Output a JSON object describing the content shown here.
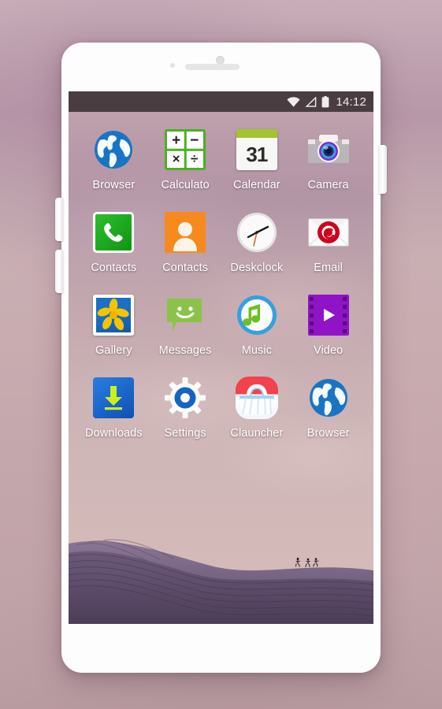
{
  "device": {
    "kind": "smartphone-mockup",
    "frame_color": "#fdfdfd",
    "buttons": [
      "volume-up",
      "volume-down",
      "power"
    ]
  },
  "background": {
    "color_top": "#c9aeb8",
    "color_bottom": "#b99ca2"
  },
  "screen": {
    "statusbar": {
      "background": "#4a3d42",
      "time": "14:12",
      "icons": [
        "wifi-icon",
        "signal-icon",
        "battery-icon"
      ]
    },
    "wallpaper": {
      "description": "lavender dunes with distant runners",
      "runner_glyphs": "\u0003\u0003\u0003",
      "dune_color": "#5d4a68",
      "sky_color": "#c6aab0"
    },
    "apps": [
      {
        "label": "Browser",
        "icon": "globe-icon",
        "accent": "#1a74c4"
      },
      {
        "label": "Calculato",
        "icon": "calculator-icon",
        "accent": "#4caf24"
      },
      {
        "label": "Calendar",
        "icon": "calendar-icon",
        "accent": "#a4c32c",
        "day": "31"
      },
      {
        "label": "Camera",
        "icon": "camera-icon",
        "accent": "#7a2fd0"
      },
      {
        "label": "Contacts",
        "icon": "phone-icon",
        "accent": "#16a81c"
      },
      {
        "label": "Contacts",
        "icon": "person-icon",
        "accent": "#f68a1e"
      },
      {
        "label": "Deskclock",
        "icon": "clock-icon",
        "accent": "#e8541a"
      },
      {
        "label": "Email",
        "icon": "email-icon",
        "accent": "#d0021b"
      },
      {
        "label": "Gallery",
        "icon": "photo-flower-icon",
        "accent": "#f2c300"
      },
      {
        "label": "Messages",
        "icon": "chat-bubble-icon",
        "accent": "#8bc34a"
      },
      {
        "label": "Music",
        "icon": "music-note-icon",
        "accent": "#36a0e0"
      },
      {
        "label": "Video",
        "icon": "film-play-icon",
        "accent": "#9013c8"
      },
      {
        "label": "Downloads",
        "icon": "download-icon",
        "accent": "#1464d2"
      },
      {
        "label": "Settings",
        "icon": "gear-icon",
        "accent": "#1565c0"
      },
      {
        "label": "Clauncher",
        "icon": "basket-icon",
        "accent": "#f2414f"
      },
      {
        "label": "Browser",
        "icon": "globe-icon",
        "accent": "#1a74c4"
      }
    ]
  }
}
